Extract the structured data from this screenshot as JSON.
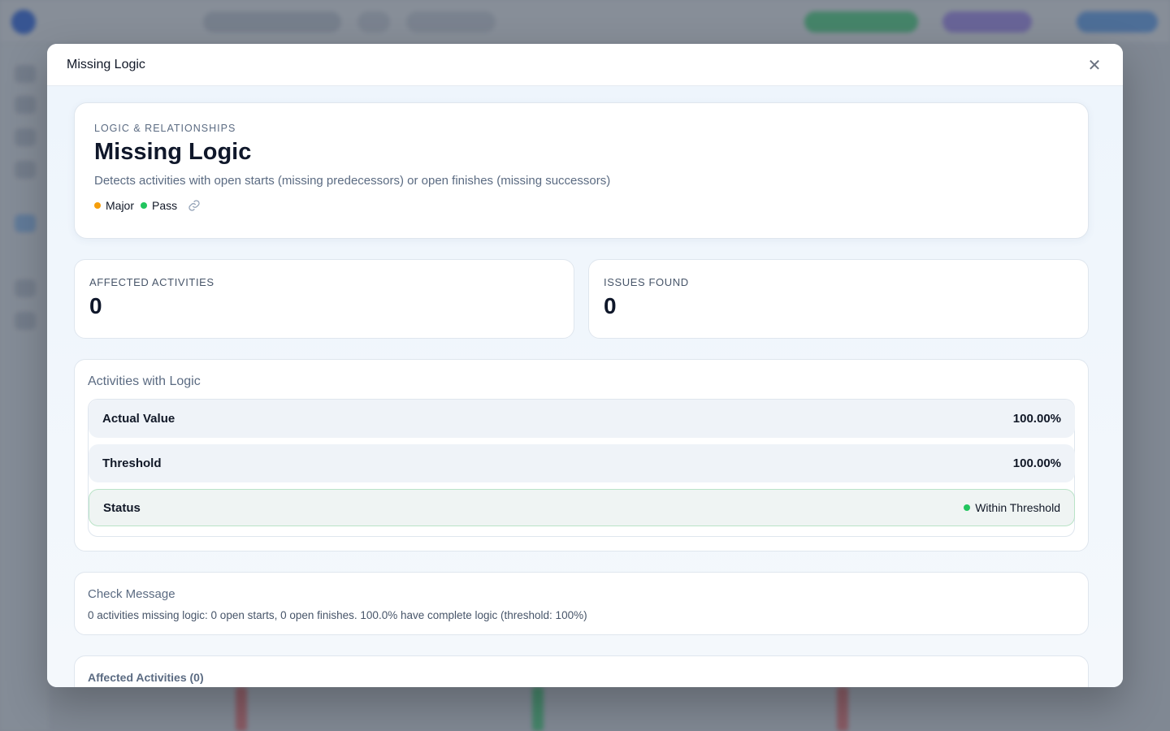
{
  "modal": {
    "title": "Missing Logic",
    "close_icon": "close-icon"
  },
  "hero": {
    "category": "LOGIC & RELATIONSHIPS",
    "title": "Missing Logic",
    "description": "Detects activities with open starts (missing predecessors) or open finishes (missing successors)",
    "severity": "Major",
    "severity_color": "#f59e0b",
    "result": "Pass",
    "result_color": "#22c55e",
    "link_icon": "link-icon"
  },
  "stats": [
    {
      "label": "AFFECTED ACTIVITIES",
      "value": "0"
    },
    {
      "label": "ISSUES FOUND",
      "value": "0"
    }
  ],
  "logic": {
    "title": "Activities with Logic",
    "rows": [
      {
        "label": "Actual Value",
        "value": "100.00%"
      },
      {
        "label": "Threshold",
        "value": "100.00%"
      },
      {
        "label": "Status",
        "value": "Within Threshold",
        "color": "#22c55e"
      }
    ]
  },
  "check_message": {
    "title": "Check Message",
    "text": "0 activities missing logic: 0 open starts, 0 open finishes. 100.0% have complete logic (threshold: 100%)"
  },
  "affected": {
    "title": "Affected Activities (0)"
  }
}
